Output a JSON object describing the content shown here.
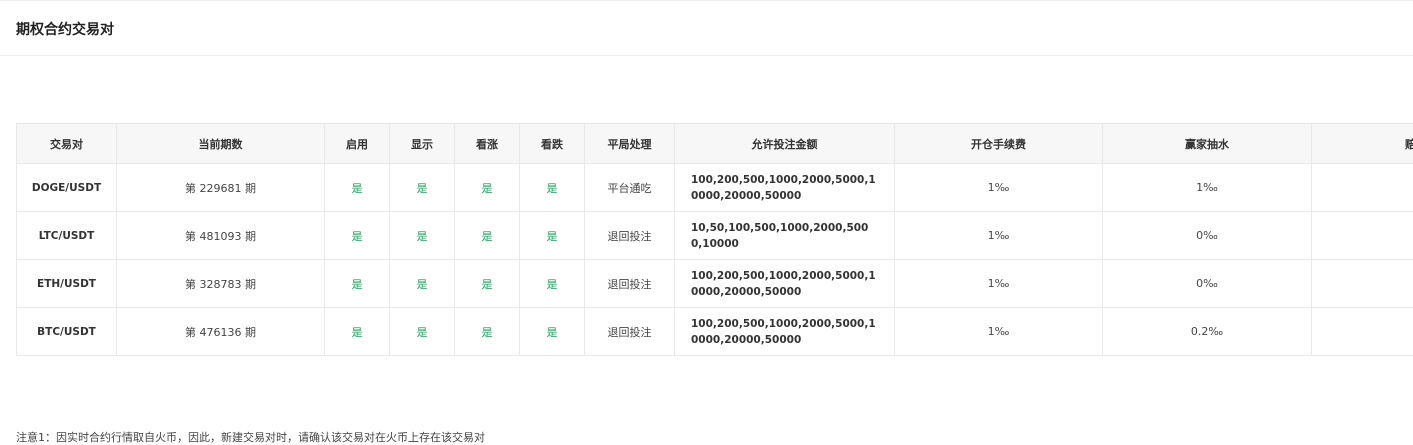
{
  "page": {
    "title": "期权合约交易对"
  },
  "table": {
    "headers": [
      "交易对",
      "当前期数",
      "启用",
      "显示",
      "看涨",
      "看跌",
      "平局处理",
      "允许投注金额",
      "开仓手续费",
      "赢家抽水",
      "赔"
    ],
    "rows": [
      {
        "pair": "DOGE/USDT",
        "period": "第 229681 期",
        "enabled": "是",
        "visible": "是",
        "call": "是",
        "put": "是",
        "draw": "平台通吃",
        "amounts": "100,200,500,1000,2000,5000,10000,20000,50000",
        "open_fee": "1‰",
        "winner_fee": "1‰",
        "extra": ""
      },
      {
        "pair": "LTC/USDT",
        "period": "第 481093 期",
        "enabled": "是",
        "visible": "是",
        "call": "是",
        "put": "是",
        "draw": "退回投注",
        "amounts": "10,50,100,500,1000,2000,5000,10000",
        "open_fee": "1‰",
        "winner_fee": "0‰",
        "extra": ""
      },
      {
        "pair": "ETH/USDT",
        "period": "第 328783 期",
        "enabled": "是",
        "visible": "是",
        "call": "是",
        "put": "是",
        "draw": "退回投注",
        "amounts": "100,200,500,1000,2000,5000,10000,20000,50000",
        "open_fee": "1‰",
        "winner_fee": "0‰",
        "extra": ""
      },
      {
        "pair": "BTC/USDT",
        "period": "第 476136 期",
        "enabled": "是",
        "visible": "是",
        "call": "是",
        "put": "是",
        "draw": "退回投注",
        "amounts": "100,200,500,1000,2000,5000,10000,20000,50000",
        "open_fee": "1‰",
        "winner_fee": "0.2‰",
        "extra": ""
      }
    ]
  },
  "note": "注意1：因实时合约行情取自火币，因此，新建交易对时，请确认该交易对在火币上存在该交易对",
  "colors": {
    "yes": "#1e9e5b",
    "header_bg": "#f7f7f7",
    "border": "#e8e8e8"
  }
}
